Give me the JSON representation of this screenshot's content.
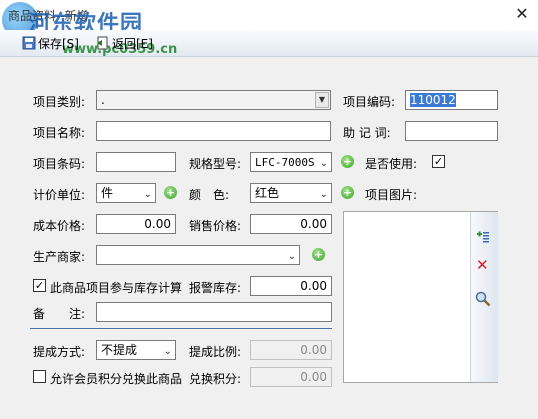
{
  "window": {
    "title": "商品资料--新增"
  },
  "watermark": {
    "line1": "河东软件园",
    "line2": "www.pc0359.cn"
  },
  "toolbar": {
    "save_label": "保存[S]",
    "back_label": "返回[E]"
  },
  "form": {
    "category_label": "项目类别:",
    "category_value": ".",
    "code_label": "项目编码:",
    "code_value": "110012",
    "name_label": "项目名称:",
    "name_value": "",
    "mnemonic_label": "助 记 词:",
    "mnemonic_value": "",
    "barcode_label": "项目条码:",
    "barcode_value": "",
    "spec_label": "规格型号:",
    "spec_value": "LFC-7000S",
    "in_use_label": "是否使用:",
    "in_use_checked": true,
    "unit_label": "计价单位:",
    "unit_value": "件",
    "color_label": "颜　色:",
    "color_value": "红色",
    "image_label": "项目图片:",
    "cost_label": "成本价格:",
    "cost_value": "0.00",
    "sale_label": "销售价格:",
    "sale_value": "0.00",
    "maker_label": "生产商家:",
    "maker_value": "",
    "stock_check_label": "此商品项目参与库存计算",
    "stock_check_checked": true,
    "alarm_label": "报警库存:",
    "alarm_value": "0.00",
    "note_label": "备　　注:",
    "note_value": "",
    "commission_mode_label": "提成方式:",
    "commission_mode_value": "不提成",
    "commission_ratio_label": "提成比例:",
    "commission_ratio_value": "0.00",
    "points_check_label": "允许会员积分兑换此商品",
    "points_check_checked": false,
    "points_label": "兑换积分:",
    "points_value": "0.00"
  },
  "icons": {
    "close": "close-icon",
    "save": "save-icon",
    "back": "back-icon",
    "add": "add-icon",
    "add_image": "add-image-icon",
    "delete_image": "delete-icon",
    "zoom": "magnifier-icon"
  }
}
